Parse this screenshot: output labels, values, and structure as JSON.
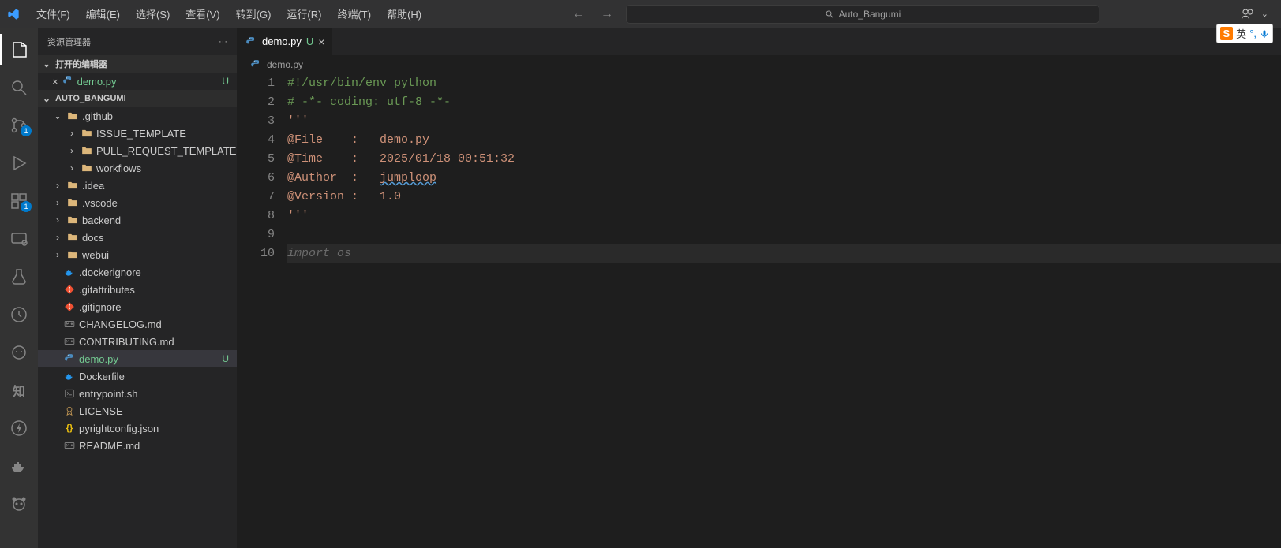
{
  "menu": {
    "items": [
      "文件(F)",
      "编辑(E)",
      "选择(S)",
      "查看(V)",
      "转到(G)",
      "运行(R)",
      "终端(T)",
      "帮助(H)"
    ]
  },
  "titlebar": {
    "search_text": "Auto_Bangumi"
  },
  "ime": {
    "logo": "S",
    "lang": "英",
    "extra1": "",
    "extra2": ""
  },
  "activity": {
    "scm_badge": "1",
    "ext_badge": "1"
  },
  "sidebar": {
    "title": "资源管理器",
    "more": "···",
    "open_editors_label": "打开的编辑器",
    "open_editors": [
      {
        "name": "demo.py",
        "status": "U"
      }
    ],
    "workspace_label": "AUTO_BANGUMI",
    "tree": {
      "github": {
        "name": ".github",
        "children": [
          "ISSUE_TEMPLATE",
          "PULL_REQUEST_TEMPLATE",
          "workflows"
        ]
      },
      "folders": [
        ".idea",
        ".vscode",
        "backend",
        "docs",
        "webui"
      ],
      "files": [
        {
          "name": ".dockerignore",
          "icon": "docker"
        },
        {
          "name": ".gitattributes",
          "icon": "git"
        },
        {
          "name": ".gitignore",
          "icon": "git"
        },
        {
          "name": "CHANGELOG.md",
          "icon": "md"
        },
        {
          "name": "CONTRIBUTING.md",
          "icon": "md"
        },
        {
          "name": "demo.py",
          "icon": "py",
          "status": "U",
          "selected": true
        },
        {
          "name": "Dockerfile",
          "icon": "docker"
        },
        {
          "name": "entrypoint.sh",
          "icon": "sh"
        },
        {
          "name": "LICENSE",
          "icon": "lic"
        },
        {
          "name": "pyrightconfig.json",
          "icon": "json"
        },
        {
          "name": "README.md",
          "icon": "md"
        }
      ]
    }
  },
  "tabs": [
    {
      "name": "demo.py",
      "status": "U"
    }
  ],
  "breadcrumb": {
    "file": "demo.py"
  },
  "code": {
    "lines": [
      {
        "n": 1,
        "tokens": [
          {
            "t": "#!/usr/bin/env python",
            "c": "comment"
          }
        ]
      },
      {
        "n": 2,
        "tokens": [
          {
            "t": "# -*- coding: utf-8 -*-",
            "c": "comment"
          }
        ]
      },
      {
        "n": 3,
        "tokens": [
          {
            "t": "'''",
            "c": "string"
          }
        ]
      },
      {
        "n": 4,
        "tokens": [
          {
            "t": "@File    :   demo.py",
            "c": "string"
          }
        ]
      },
      {
        "n": 5,
        "tokens": [
          {
            "t": "@Time    :   2025/01/18 00:51:32",
            "c": "string"
          }
        ]
      },
      {
        "n": 6,
        "tokens": [
          {
            "t": "@Author  :   ",
            "c": "string"
          },
          {
            "t": "jumploop",
            "c": "string underline"
          }
        ]
      },
      {
        "n": 7,
        "tokens": [
          {
            "t": "@Version :   1.0",
            "c": "string"
          }
        ]
      },
      {
        "n": 8,
        "tokens": [
          {
            "t": "'''",
            "c": "string"
          }
        ]
      },
      {
        "n": 9,
        "tokens": []
      },
      {
        "n": 10,
        "current": true,
        "tokens": [
          {
            "t": "import os",
            "c": "suggest"
          }
        ]
      }
    ]
  }
}
